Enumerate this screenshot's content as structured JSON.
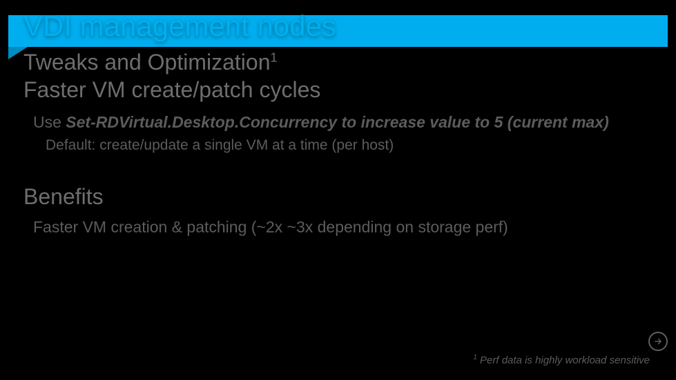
{
  "title": "VDI management nodes",
  "subtitle_line1_prefix": "Tweaks and Optimization",
  "subtitle_line1_sup": "1",
  "subtitle_line2": "Faster VM create/patch cycles",
  "body": {
    "line1_lead": "Use ",
    "line1_command": "Set-RDVirtual.Desktop.Concurrency to increase value to 5 (current max)",
    "line2": "Default: create/update a single VM at a time (per host)"
  },
  "benefits_heading": "Benefits",
  "benefits_line": "Faster VM creation & patching (~2x ~3x depending on storage perf)",
  "footnote_sup": "1",
  "footnote_text": " Perf data is highly workload sensitive",
  "colors": {
    "accent": "#00AEEF"
  }
}
